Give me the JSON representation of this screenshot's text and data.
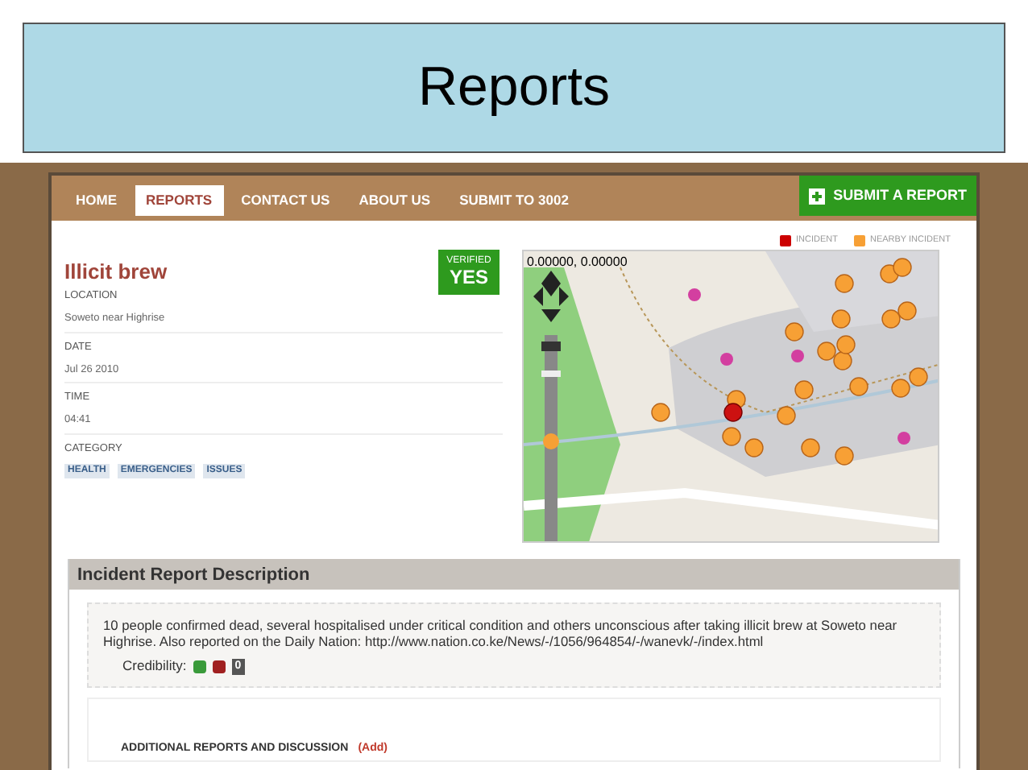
{
  "slide_title": "Reports",
  "nav": {
    "tabs": [
      {
        "label": "HOME",
        "selected": false
      },
      {
        "label": "REPORTS",
        "selected": true
      },
      {
        "label": "CONTACT US",
        "selected": false
      },
      {
        "label": "ABOUT US",
        "selected": false
      },
      {
        "label": "SUBMIT TO 3002",
        "selected": false
      }
    ],
    "submit_button": "SUBMIT A REPORT"
  },
  "legend": [
    {
      "label": "INCIDENT",
      "color": "#cc0000"
    },
    {
      "label": "NEARBY INCIDENT",
      "color": "#f7a035"
    }
  ],
  "report": {
    "title": "Illicit brew",
    "verified": {
      "label": "VERIFIED",
      "value": "YES"
    },
    "fields": [
      {
        "label": "LOCATION",
        "value": "Soweto near Highrise"
      },
      {
        "label": "DATE",
        "value": "Jul 26 2010"
      },
      {
        "label": "TIME",
        "value": "04:41"
      }
    ],
    "category_label": "CATEGORY",
    "categories": [
      "HEALTH",
      "EMERGENCIES",
      "ISSUES"
    ]
  },
  "map": {
    "coordinates": "0.00000, 0.00000"
  },
  "description": {
    "heading": "Incident Report Description",
    "text": "10 people confirmed dead, several hospitalised under critical condition and others unconscious after taking illicit brew at Soweto near Highrise. Also reported on the Daily Nation: http://www.nation.co.ke/News/-/1056/964854/-/wanevk/-/index.html",
    "credibility_label": "Credibility:",
    "credibility_count": "0"
  },
  "discussion": {
    "heading": "ADDITIONAL REPORTS AND DISCUSSION",
    "add_link": "(Add)"
  }
}
